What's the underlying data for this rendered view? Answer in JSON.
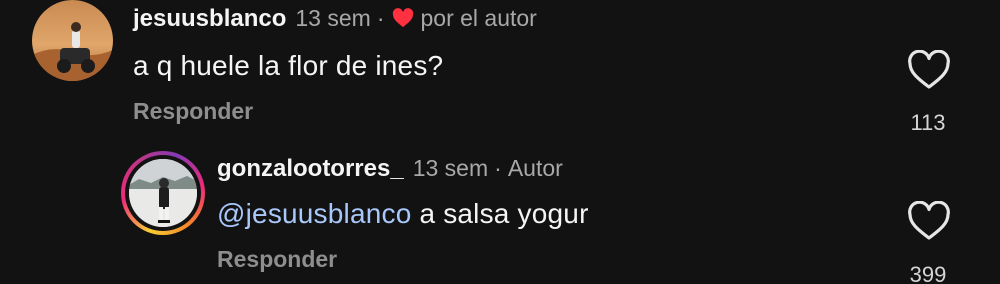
{
  "comments": [
    {
      "username": "jesuusblanco",
      "time": "13 sem",
      "separator": "·",
      "liked_by_author": "por el autor",
      "text": "a q huele la flor de ines?",
      "reply_label": "Responder",
      "likes": "113"
    }
  ],
  "reply": {
    "username": "gonzalootorres_",
    "time": "13 sem",
    "separator": "·",
    "badge": "Autor",
    "mention": "@jesuusblanco",
    "text": " a salsa yogur",
    "reply_label": "Responder",
    "likes": "399"
  },
  "colors": {
    "background": "#121212",
    "heart_red": "#ff3040",
    "mention": "#a8c7fa"
  },
  "icons": [
    "red-heart-icon",
    "like-heart-icon"
  ]
}
